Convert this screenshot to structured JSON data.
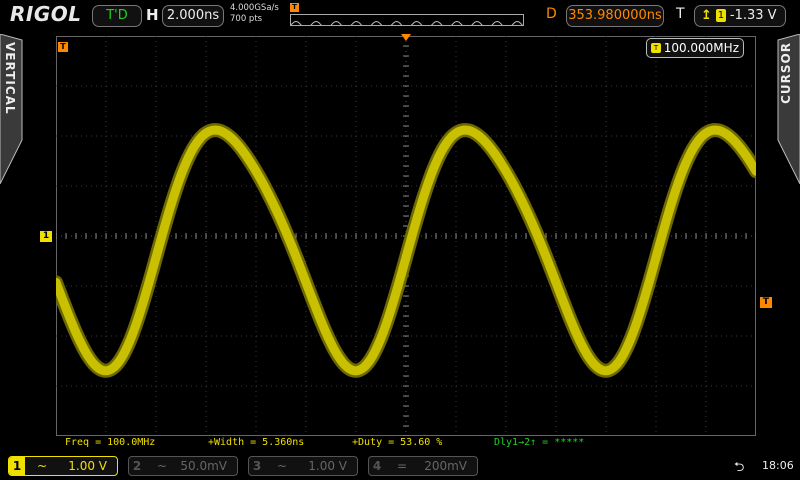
{
  "header": {
    "brand": "RIGOL",
    "status": "T'D",
    "h_label": "H",
    "timebase": "2.000ns",
    "sample_rate": "4.000GSa/s",
    "memory_depth": "700 pts",
    "d_label": "D",
    "delay": "353.980000ns",
    "t_label": "T",
    "trigger_channel": "1",
    "trigger_level": "-1.33 V"
  },
  "side_tabs": {
    "left": "VERTICAL",
    "right": "CURSOR"
  },
  "markers": {
    "trigger_top": "T",
    "channel1": "1",
    "trigger_level_right": "T",
    "trigger_left": "T"
  },
  "freq_counter": {
    "icon": "T",
    "value": "100.000MHz"
  },
  "measurements": {
    "freq": "Freq = 100.0MHz",
    "width": "+Width = 5.360ns",
    "duty": "+Duty = 53.60 %",
    "delay": "Dly1→2↑ = *****"
  },
  "channels": [
    {
      "num": "1",
      "coupling": "~",
      "scale": "1.00 V",
      "active": true
    },
    {
      "num": "2",
      "coupling": "~",
      "scale": "50.0mV",
      "active": false
    },
    {
      "num": "3",
      "coupling": "~",
      "scale": "1.00 V",
      "active": false
    },
    {
      "num": "4",
      "coupling": "=",
      "scale": "200mV",
      "active": false
    }
  ],
  "status_bar": {
    "usb_icon": "usb-icon",
    "time": "18:06"
  },
  "waveform": {
    "signal": "sine",
    "frequency": "100.0MHz",
    "visible_periods": 2.8,
    "color": "#c8c000"
  },
  "colors": {
    "ch1": "#f0e000",
    "trigger": "#ff8800",
    "ok": "#20d020"
  }
}
